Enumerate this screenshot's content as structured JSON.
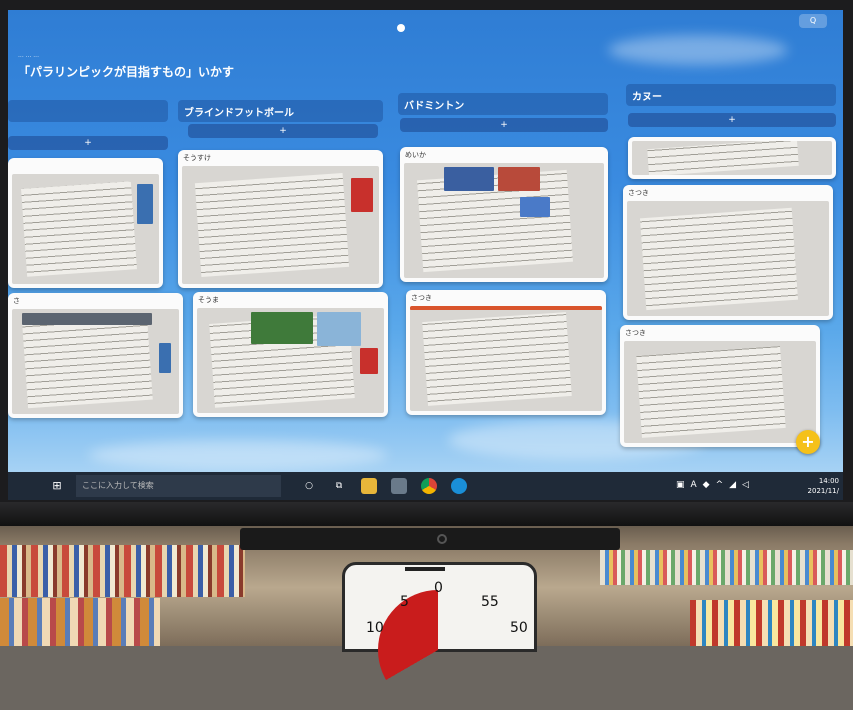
{
  "board": {
    "crumb": "... ... ...",
    "title": "「パラリンピックが目指すもの」いかす",
    "subtitle": "",
    "top_button": "Q"
  },
  "columns": [
    {
      "name": "",
      "add": "+"
    },
    {
      "name": "ブラインドフットボール",
      "add": "+"
    },
    {
      "name": "バドミントン",
      "add": "+"
    },
    {
      "name": "カヌー",
      "add": "+"
    }
  ],
  "cards": [
    {
      "author": ""
    },
    {
      "author": "そうすけ"
    },
    {
      "author": "めいか"
    },
    {
      "author": ""
    },
    {
      "author": "さ"
    },
    {
      "author": "そうま"
    },
    {
      "author": "さつき"
    },
    {
      "author": "さつき"
    },
    {
      "author": "さつき"
    }
  ],
  "taskbar": {
    "search_placeholder": "ここに入力して検索",
    "time": "14:00",
    "date": "2021/11/"
  },
  "timer": {
    "labels": [
      "0",
      "5",
      "55",
      "10",
      "50"
    ]
  },
  "colors": {
    "screen_top": "#2f7dd4",
    "fab": "#f5c11a",
    "timer_red": "#c91c1c"
  }
}
